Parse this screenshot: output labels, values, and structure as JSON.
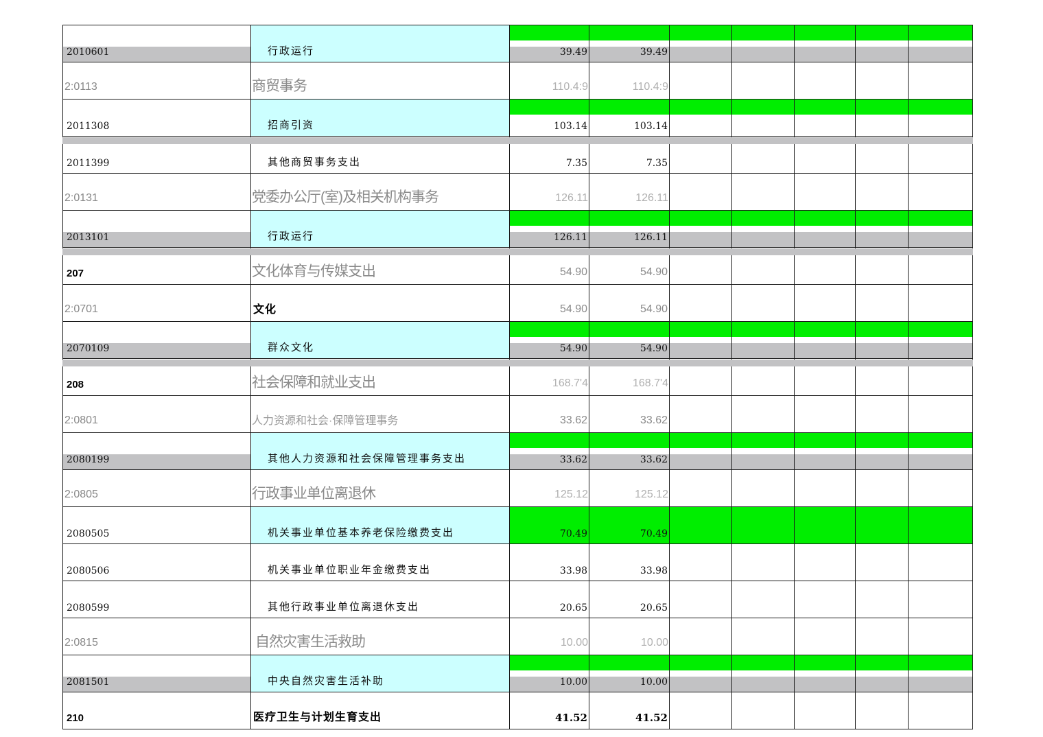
{
  "rows": [
    {
      "code": "2010601",
      "name": "行政运行",
      "v1": "39.49",
      "v2": "39.49",
      "style": "detail",
      "green": true,
      "gray": true
    },
    {
      "code": "2:0113",
      "name": "商贸事务",
      "v1": "110.4:9",
      "v2": "110.4:9",
      "style": "section",
      "green": false,
      "gray": false
    },
    {
      "code": "2011308",
      "name": "招商引资",
      "v1": "103.14",
      "v2": "103.14",
      "style": "detail",
      "green": true,
      "gray": false,
      "grayBottom": true
    },
    {
      "code": "2011399",
      "name": "其他商贸事务支出",
      "v1": "7.35",
      "v2": "7.35",
      "style": "plain",
      "green": false,
      "gray": false
    },
    {
      "code": "2:0131",
      "name": "党委办公厅(室)及相关机构事务",
      "v1": "126.11",
      "v2": "126.11",
      "style": "section",
      "green": false,
      "gray": false
    },
    {
      "code": "2013101",
      "name": "行政运行",
      "v1": "126.11",
      "v2": "126.11",
      "style": "detail",
      "green": true,
      "gray": true,
      "grayBottom": true
    },
    {
      "code": "207",
      "name": "文化体育与传媒支出",
      "v1": "54.90",
      "v2": "54.90",
      "style": "category",
      "green": false,
      "gray": false
    },
    {
      "code": "2:0701",
      "name": "文化",
      "v1": "54.90",
      "v2": "54.90",
      "style": "boldname",
      "green": false,
      "gray": false
    },
    {
      "code": "2070109",
      "name": "群众文化",
      "v1": "54.90",
      "v2": "54.90",
      "style": "detail",
      "green": true,
      "gray": true,
      "grayBottom": true
    },
    {
      "code": "208",
      "name": "社会保障和就业支出",
      "v1": "168.7'4",
      "v2": "168.7'4",
      "style": "category2",
      "green": false,
      "gray": false
    },
    {
      "code": "2:0801",
      "name": "人力资源和社会·保障管理事务",
      "v1": "33.62",
      "v2": "33.62",
      "style": "section-small",
      "green": false,
      "gray": false
    },
    {
      "code": "2080199",
      "name": "其他人力资源和社会保障管理事务支出",
      "v1": "33.62",
      "v2": "33.62",
      "style": "detail",
      "green": true,
      "gray": true
    },
    {
      "code": "2:0805",
      "name": "行政事业单位离退休",
      "v1": "125.12",
      "v2": "125.12",
      "style": "section",
      "green": false,
      "gray": false
    },
    {
      "code": "2080505",
      "name": "机关事业单位基本养老保险缴费支出",
      "v1": "70.49",
      "v2": "70.49",
      "style": "detail-fullgreen",
      "green": true,
      "gray": false
    },
    {
      "code": "2080506",
      "name": "机关事业单位职业年金缴费支出",
      "v1": "33.98",
      "v2": "33.98",
      "style": "plain-topgray",
      "green": false,
      "gray": false
    },
    {
      "code": "2080599",
      "name": "其他行政事业单位离退休支出",
      "v1": "20.65",
      "v2": "20.65",
      "style": "plain",
      "green": false,
      "gray": false
    },
    {
      "code": "2:0815",
      "name": "自然灾害生活救助",
      "v1": "10.00",
      "v2": "10.00",
      "style": "section-indent",
      "green": false,
      "gray": false
    },
    {
      "code": "2081501",
      "name": "中央自然灾害生活补助",
      "v1": "10.00",
      "v2": "10.00",
      "style": "detail",
      "green": true,
      "gray": true
    },
    {
      "code": "210",
      "name": "医疗卫生与计划生育支出",
      "v1": "41.52",
      "v2": "41.52",
      "style": "total",
      "green": false,
      "gray": false
    }
  ],
  "colors": {
    "green": "#00ee00",
    "cyan": "#ccffff",
    "gray": "#c2c2c4"
  }
}
